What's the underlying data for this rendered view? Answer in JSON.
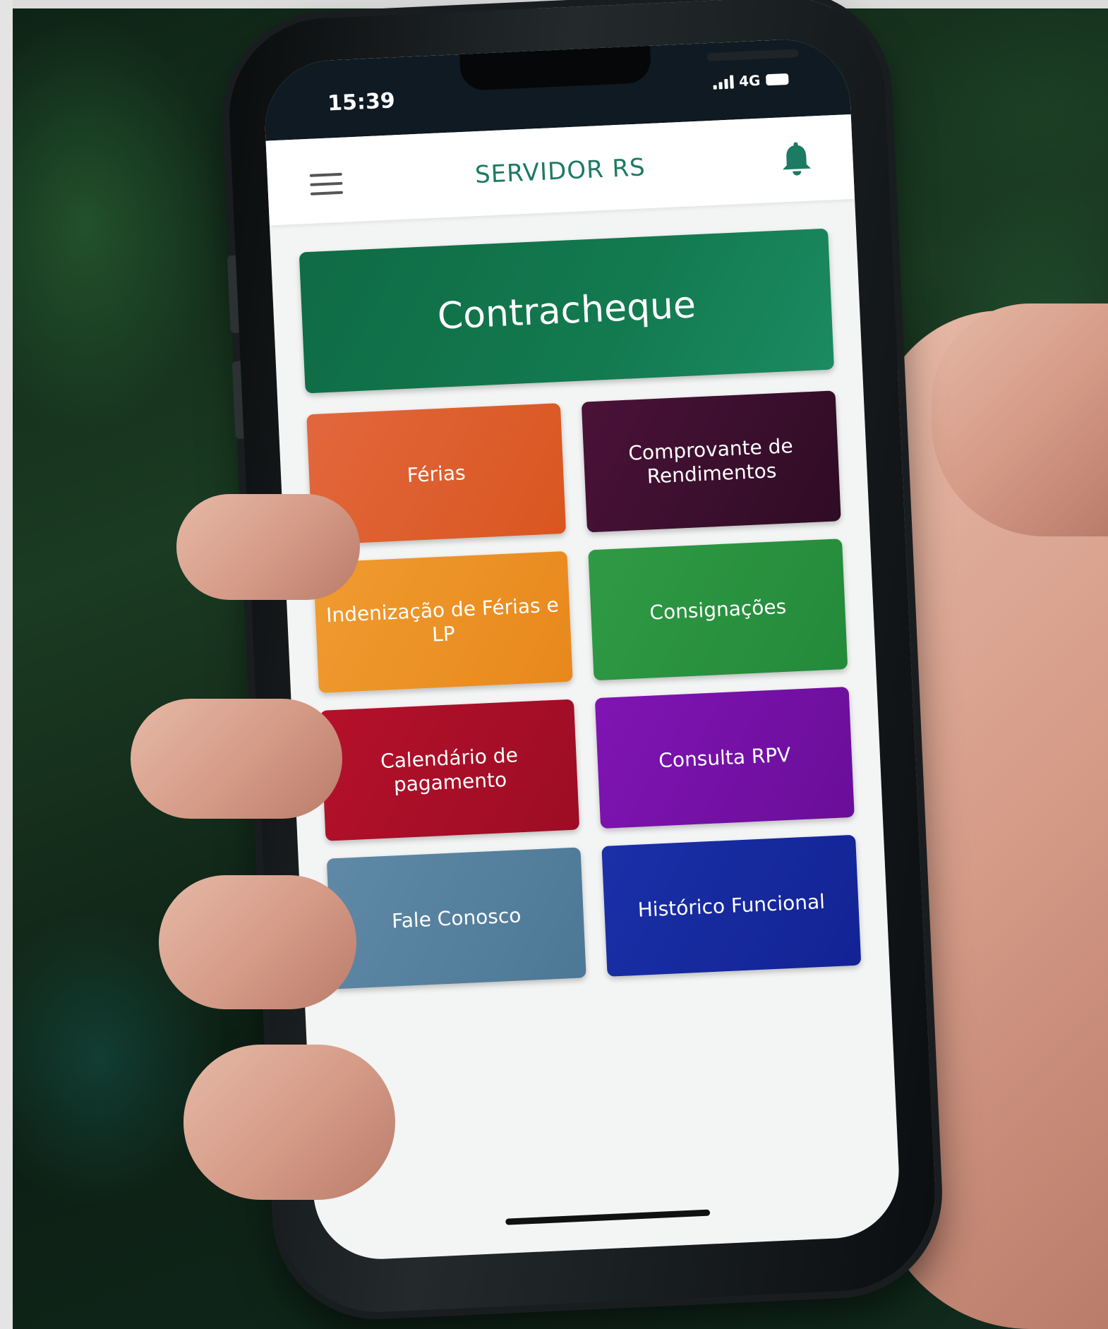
{
  "status_bar": {
    "time": "15:39",
    "network": "4G"
  },
  "header": {
    "title": "SERVIDOR RS",
    "menu_icon": "hamburger-menu-icon",
    "bell_icon": "bell-icon"
  },
  "tiles": {
    "contracheque": "Contracheque",
    "ferias": "Férias",
    "comprovante": "Comprovante de Rendimentos",
    "indenizacao": "Indenização de Férias e LP",
    "consignacoes": "Consignações",
    "calendario": "Calendário de pagamento",
    "rpv": "Consulta RPV",
    "fale": "Fale Conosco",
    "historico": "Histórico Funcional"
  },
  "colors": {
    "contracheque": "#137a4f",
    "ferias": "#dd5d2c",
    "comprovante": "#3d0f2f",
    "indenizacao": "#ec9126",
    "consignacoes": "#2a9340",
    "calendario": "#aa0f28",
    "rpv": "#7511a6",
    "fale": "#5680a0",
    "historico": "#16299e",
    "title": "#1d7a63"
  }
}
